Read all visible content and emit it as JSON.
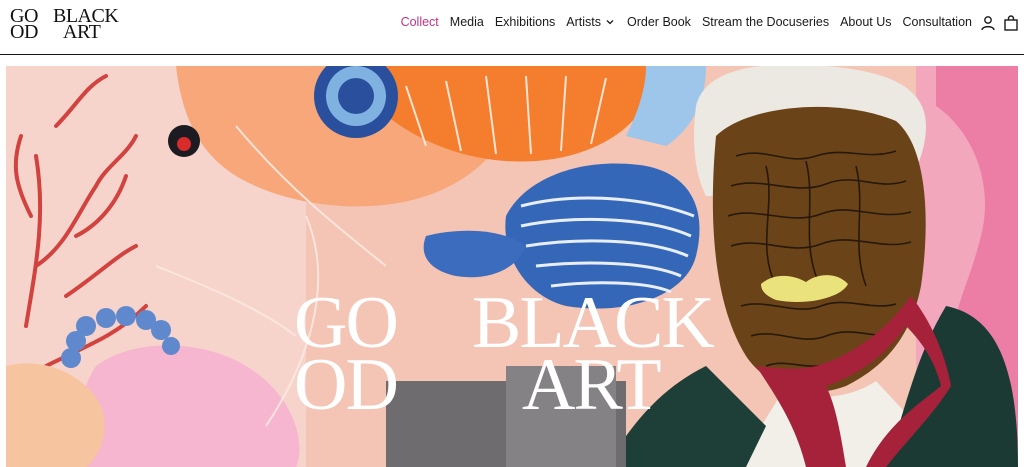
{
  "brand": {
    "logo_col1_line1": "GO",
    "logo_col1_line2": "OD",
    "logo_col2_line1": "BLACK",
    "logo_col2_line2": "ART"
  },
  "nav": {
    "items": [
      {
        "label": "Collect",
        "active": true
      },
      {
        "label": "Media"
      },
      {
        "label": "Exhibitions"
      },
      {
        "label": "Artists",
        "has_dropdown": true
      },
      {
        "label": "Order Book"
      },
      {
        "label": "Stream the Docuseries"
      },
      {
        "label": "About Us"
      },
      {
        "label": "Consultation"
      }
    ],
    "active_color": "#c0348a"
  },
  "icons": {
    "account": "account-icon",
    "bag": "shopping-bag-icon",
    "dropdown": "chevron-down-icon"
  },
  "hero": {
    "logo_col1_line1": "GO",
    "logo_col1_line2": "OD",
    "logo_col2_line1": "BLACK",
    "logo_col2_line2": "ART"
  }
}
